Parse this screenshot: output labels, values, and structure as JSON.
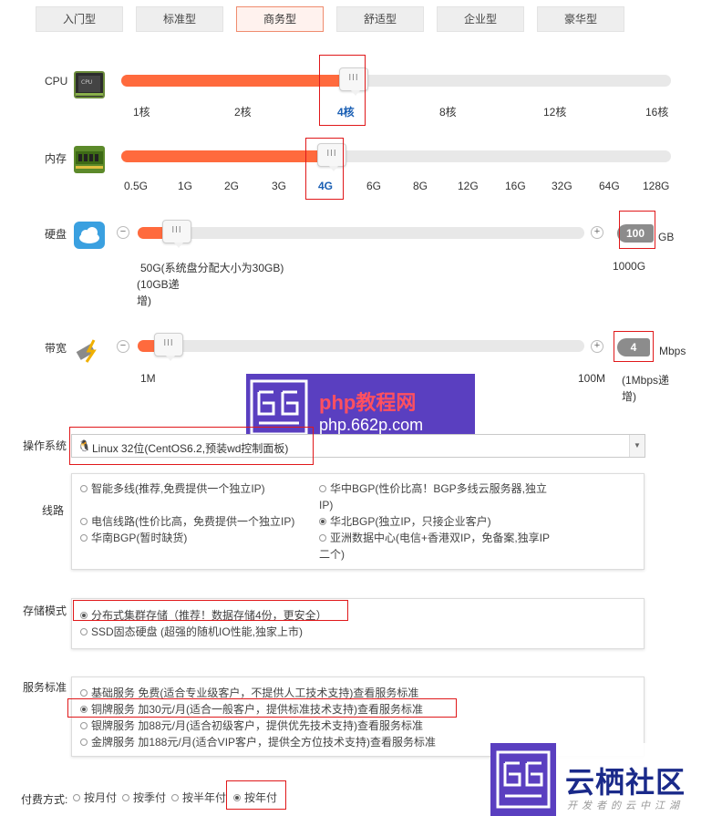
{
  "tabs": [
    "入门型",
    "标准型",
    "商务型",
    "舒适型",
    "企业型",
    "豪华型"
  ],
  "cpu": {
    "label": "CPU",
    "ticks": [
      "1核",
      "2核",
      "4核",
      "8核",
      "12核",
      "16核"
    ],
    "selected": "4核",
    "level": 0.4
  },
  "memory": {
    "label": "内存",
    "ticks": [
      "0.5G",
      "1G",
      "2G",
      "3G",
      "4G",
      "6G",
      "8G",
      "12G",
      "16G",
      "32G",
      "64G",
      "128G"
    ],
    "selected": "4G",
    "level": 0.36
  },
  "disk": {
    "label": "硬盘",
    "value": "100",
    "unit": "GB",
    "min_label": "50G(系统盘分配大小为30GB)",
    "step_label_1": "(10GB递",
    "step_label_2": "增)",
    "max_label": "1000G",
    "minus": "−",
    "plus": "+",
    "level": 0.06
  },
  "bandwidth": {
    "label": "带宽",
    "value": "4",
    "unit": "Mbps",
    "min_label": "1M",
    "max_label": "100M",
    "step_label_1": "(1Mbps递",
    "step_label_2": "增)",
    "minus": "−",
    "plus": "+",
    "level": 0.04
  },
  "watermark_top": {
    "site": "php教程网",
    "url": "php.662p.com"
  },
  "os": {
    "label": "操作系统",
    "value": "Linux 32位(CentOS6.2,预装wd控制面板)"
  },
  "line": {
    "label": "线路",
    "options": [
      {
        "text": "智能多线(推荐,免费提供一个独立IP)",
        "on": false
      },
      {
        "text": "华中BGP(性价比高！BGP多线云服务器,独立",
        "on": false
      },
      {
        "text": "IP)",
        "on": false
      },
      {
        "text": "电信线路(性价比高，免费提供一个独立IP)",
        "on": false
      },
      {
        "text": "华北BGP(独立IP，只接企业客户)",
        "on": true
      },
      {
        "text": "华南BGP(暂时缺货)",
        "on": false
      },
      {
        "text": "亚洲数据中心(电信+香港双IP，免备案,独享IP",
        "on": false
      },
      {
        "text": "二个)",
        "on": false
      }
    ]
  },
  "storage": {
    "label": "存储模式",
    "options": [
      {
        "text": "分布式集群存储（推荐！数据存储4份，更安全）",
        "on": true
      },
      {
        "text": "SSD固态硬盘 (超强的随机IO性能,独家上市)",
        "on": false
      }
    ]
  },
  "service": {
    "label": "服务标准",
    "options": [
      {
        "text": "基础服务  免费(适合专业级客户，不提供人工技术支持)查看服务标准",
        "on": false
      },
      {
        "text": "铜牌服务  加30元/月(适合一般客户，提供标准技术支持)查看服务标准",
        "on": true
      },
      {
        "text": "银牌服务  加88元/月(适合初级客户，提供优先技术支持)查看服务标准",
        "on": false
      },
      {
        "text": "金牌服务  加188元/月(适合VIP客户，提供全方位技术支持)查看服务标准",
        "on": false
      }
    ]
  },
  "payment": {
    "label": "付费方式:",
    "options": [
      {
        "text": "按月付",
        "on": false
      },
      {
        "text": "按季付",
        "on": false
      },
      {
        "text": "按半年付",
        "on": false
      },
      {
        "text": "按年付",
        "on": true
      }
    ]
  },
  "watermark_bottom": {
    "site": "云栖社区",
    "tagline": "开发者的云中江湖"
  },
  "colors": {
    "accent": "#ff6a3d",
    "highlight": "#e0181a",
    "selected_tick": "#1a5fb4",
    "watermark": "#5a3fc0"
  }
}
